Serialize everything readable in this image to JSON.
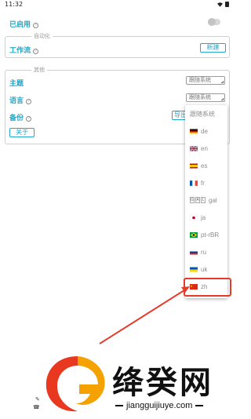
{
  "status_bar": {
    "time": "11:32"
  },
  "settings": {
    "enabled_label": "已启用",
    "automation_group_title": "自动化",
    "workflow_label": "工作流",
    "new_button": "新建",
    "other_group_title": "其他",
    "theme_label": "主题",
    "theme_value": "跟随系统",
    "language_label": "语言",
    "language_value": "跟随系统",
    "backup_label": "备份",
    "export_button": "导出",
    "about_button": "关于"
  },
  "language_dropdown": {
    "items": [
      {
        "label": "跟随系统",
        "flag": ""
      },
      {
        "label": "de",
        "flag": "germany-flag"
      },
      {
        "label": "en",
        "flag": "uk-flag"
      },
      {
        "label": "es",
        "flag": "spain-flag"
      },
      {
        "label": "fr",
        "flag": "france-flag"
      },
      {
        "label": "gal",
        "flag": "galician-letters",
        "badge": [
          "G",
          "A",
          "L"
        ]
      },
      {
        "label": "ja",
        "flag": "japan-flag"
      },
      {
        "label": "pt-rBR",
        "flag": "brazil-flag"
      },
      {
        "label": "ru",
        "flag": "russia-flag"
      },
      {
        "label": "uk",
        "flag": "ukraine-flag"
      },
      {
        "label": "zh",
        "flag": "china-flag"
      }
    ],
    "highlighted": "zh",
    "highlight_color": "#e53b2b"
  },
  "colors": {
    "accent": "#20a7c9",
    "annotation": "#e53b2b"
  },
  "watermark": {
    "name": "绛癸网",
    "url": "jiangguijiuye.com"
  }
}
